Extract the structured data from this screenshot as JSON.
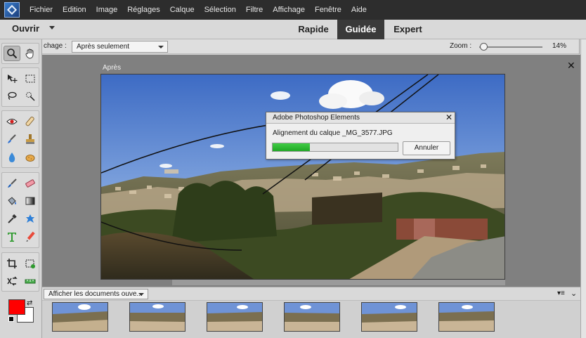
{
  "menubar": {
    "logo": "photoshop-elements-logo",
    "items": [
      "Fichier",
      "Edition",
      "Image",
      "Réglages",
      "Calque",
      "Sélection",
      "Filtre",
      "Affichage",
      "Fenêtre",
      "Aide"
    ]
  },
  "modebar": {
    "open_label": "Ouvrir",
    "tabs": [
      {
        "label": "Rapide",
        "active": false
      },
      {
        "label": "Guidée",
        "active": true
      },
      {
        "label": "Expert",
        "active": false
      }
    ]
  },
  "options": {
    "view_label": "chage :",
    "view_value": "Après seulement",
    "zoom_label": "Zoom :",
    "zoom_value": "14%",
    "zoom_level": 0.14
  },
  "document": {
    "label": "Après",
    "close_icon": "close-icon"
  },
  "dialog": {
    "title": "Adobe Photoshop Elements",
    "message": "Alignement du calque _MG_3577.JPG",
    "progress": 0.3,
    "cancel_label": "Annuler"
  },
  "bin": {
    "select_value": "Afficher les documents ouve..."
  },
  "colors": {
    "foreground": "#ff0000",
    "background": "#ffffff",
    "menubar": "#2d2d2d",
    "active_tab": "#3a3a3a",
    "progress": "#2fbb35"
  },
  "tools": [
    "zoom-icon",
    "hand-icon",
    "move-icon",
    "marquee-icon",
    "lasso-icon",
    "quick-selection-icon",
    "red-eye-icon",
    "spot-healing-icon",
    "smart-brush-icon",
    "clone-stamp-icon",
    "blur-icon",
    "sponge-icon",
    "brush-icon",
    "eraser-icon",
    "paint-bucket-icon",
    "gradient-icon",
    "eyedropper-icon",
    "custom-shape-icon",
    "type-icon",
    "pencil-icon",
    "crop-icon",
    "recompose-icon",
    "content-aware-move-icon",
    "straighten-icon"
  ]
}
